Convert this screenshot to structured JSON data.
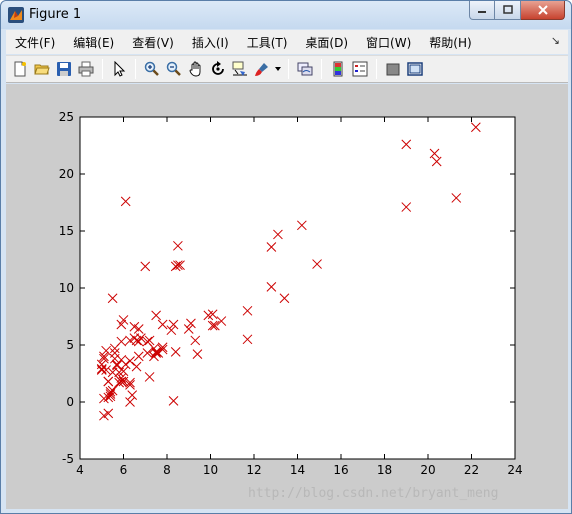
{
  "window": {
    "title": "Figure 1",
    "icon": "matlab-icon"
  },
  "menu": [
    {
      "label": "文件(F)"
    },
    {
      "label": "编辑(E)"
    },
    {
      "label": "查看(V)"
    },
    {
      "label": "插入(I)"
    },
    {
      "label": "工具(T)"
    },
    {
      "label": "桌面(D)"
    },
    {
      "label": "窗口(W)"
    },
    {
      "label": "帮助(H)"
    }
  ],
  "toolbar": [
    {
      "icon": "new-figure-icon"
    },
    {
      "icon": "open-file-icon"
    },
    {
      "icon": "save-icon"
    },
    {
      "icon": "print-icon"
    },
    {
      "icon": "edit-plot-icon"
    },
    {
      "icon": "zoom-in-icon"
    },
    {
      "icon": "zoom-out-icon"
    },
    {
      "icon": "pan-icon"
    },
    {
      "icon": "rotate-3d-icon"
    },
    {
      "icon": "data-cursor-icon"
    },
    {
      "icon": "brush-icon"
    },
    {
      "icon": "link-plot-icon"
    },
    {
      "icon": "insert-colorbar-icon"
    },
    {
      "icon": "insert-legend-icon"
    },
    {
      "icon": "hide-plot-tools-icon"
    },
    {
      "icon": "show-plot-tools-icon"
    }
  ],
  "watermark": "http://blog.csdn.net/bryant_meng",
  "colors": {
    "marker": "#cc0000",
    "figure_bg": "#cccccc",
    "axes_bg": "#ffffff"
  },
  "chart_data": {
    "type": "scatter",
    "marker": "x",
    "grid": false,
    "xlim": [
      4,
      24
    ],
    "ylim": [
      -5,
      25
    ],
    "xticks": [
      "4",
      "6",
      "8",
      "10",
      "12",
      "14",
      "16",
      "18",
      "20",
      "22",
      "24"
    ],
    "yticks": [
      "-5",
      "0",
      "5",
      "10",
      "15",
      "20",
      "25"
    ],
    "x": [
      6.1,
      5.5,
      8.5,
      7.0,
      5.9,
      8.4,
      5.6,
      8.6,
      6.5,
      5.1,
      5.7,
      14.2,
      5.7,
      12.8,
      6.7,
      5.9,
      6.4,
      5.6,
      6.3,
      7.1,
      5.0,
      5.1,
      10.2,
      5.5,
      5.1,
      5.0,
      20.3,
      10.1,
      7.4,
      7.2,
      6.0,
      8.2,
      7.6,
      5.9,
      8.3,
      6.3,
      5.3,
      6.3,
      5.0,
      6.0,
      6.6,
      5.6,
      7.2,
      5.0,
      6.1,
      5.9,
      7.8,
      5.9,
      6.5,
      5.4,
      5.2,
      5.9,
      5.4,
      5.8,
      6.6,
      9.9,
      5.4,
      6.3,
      8.4,
      5.3,
      13.4,
      7.8,
      7.8,
      5.3,
      9.4,
      9.1,
      12.8,
      14.9,
      6.8,
      6.3,
      7.5,
      10.1,
      9.0,
      22.2,
      21.3,
      19.0,
      20.4,
      19.0,
      13.1,
      8.5,
      7.1,
      10.5,
      11.7,
      11.7,
      9.3,
      8.3,
      6.7,
      7.4,
      7.5,
      6.0,
      5.2,
      5.1,
      5.5,
      5.8,
      5.3,
      6.7,
      7.5
    ],
    "y": [
      17.6,
      9.1,
      13.7,
      11.9,
      6.8,
      11.9,
      4.3,
      12.0,
      6.6,
      3.8,
      3.3,
      15.5,
      3.2,
      13.6,
      4.0,
      5.3,
      0.6,
      3.8,
      3.6,
      4.3,
      3.3,
      0.3,
      6.7,
      1.0,
      4.0,
      2.9,
      21.8,
      7.7,
      4.0,
      5.4,
      1.8,
      6.3,
      4.3,
      1.8,
      0.1,
      1.7,
      1.8,
      5.4,
      2.8,
      2.7,
      5.4,
      4.7,
      2.2,
      2.9,
      3.3,
      1.8,
      6.8,
      2.1,
      5.6,
      0.7,
      4.5,
      3.7,
      0.5,
      1.7,
      3.1,
      7.6,
      0.9,
      0.0,
      4.4,
      0.4,
      9.1,
      4.6,
      4.8,
      1.8,
      4.2,
      6.9,
      10.1,
      12.1,
      5.6,
      1.5,
      4.4,
      6.7,
      6.4,
      24.1,
      17.9,
      22.6,
      21.1,
      17.1,
      14.7,
      12.0,
      5.3,
      7.1,
      8.0,
      5.5,
      5.4,
      6.8,
      6.4,
      4.7,
      7.6,
      7.2,
      2.8,
      -1.2,
      2.6,
      2.6,
      -1.0,
      5.3,
      4.3
    ]
  }
}
